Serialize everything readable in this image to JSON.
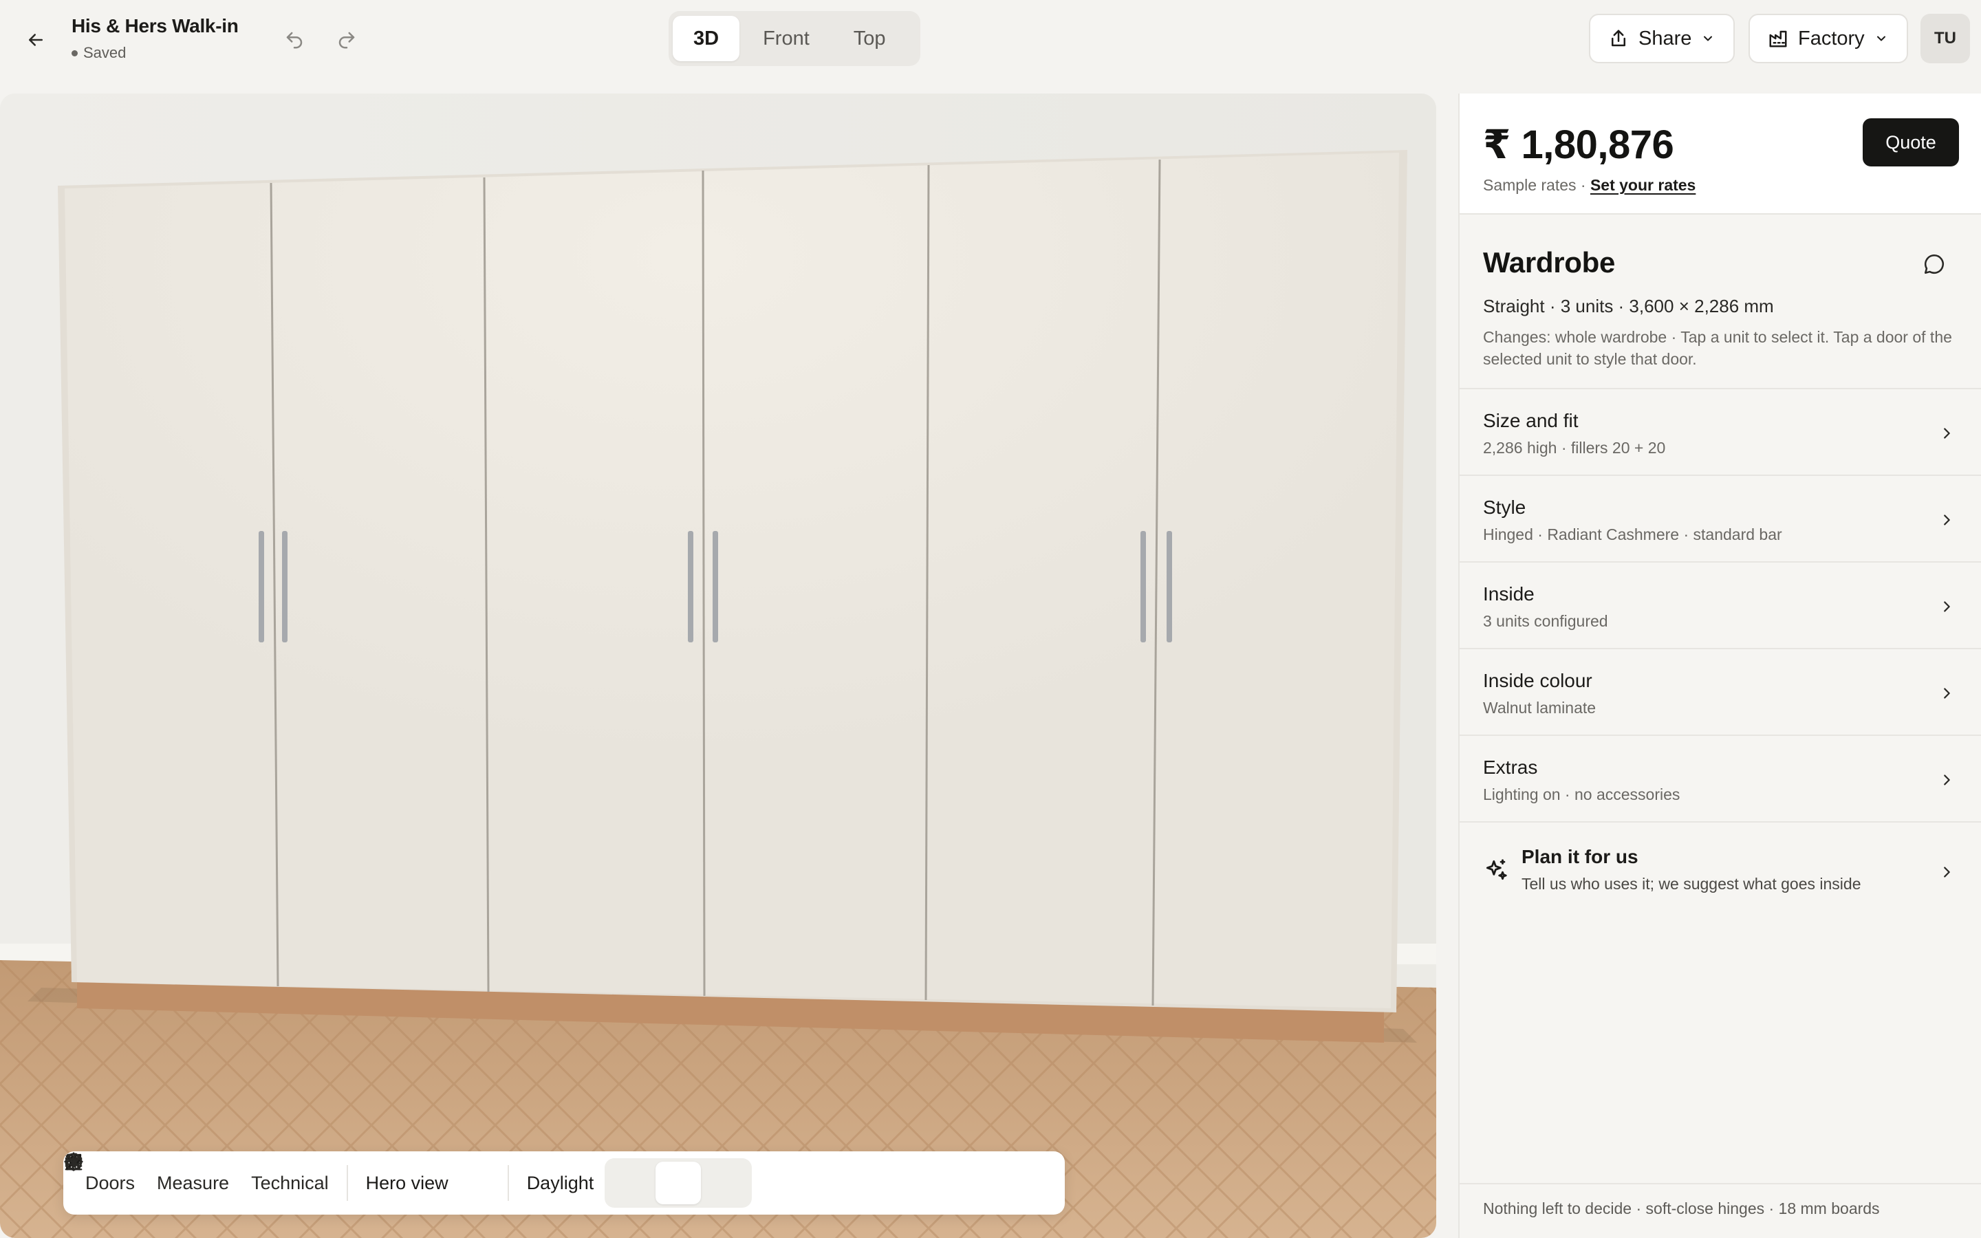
{
  "header": {
    "title": "His & Hers Walk-in",
    "status": "Saved",
    "views": [
      {
        "label": "3D",
        "active": true
      },
      {
        "label": "Front",
        "active": false
      },
      {
        "label": "Top",
        "active": false
      }
    ],
    "share_label": "Share",
    "factory_label": "Factory",
    "avatar_initials": "TU"
  },
  "toolbar": {
    "doors": "Doors",
    "measure": "Measure",
    "technical": "Technical",
    "camera": "Hero view",
    "lighting": "Daylight"
  },
  "panel": {
    "price": "₹ 1,80,876",
    "rates_prefix": "Sample rates ·",
    "rates_link": "Set your rates",
    "quote_label": "Quote",
    "wardrobe": {
      "title": "Wardrobe",
      "summary": "Straight · 3 units · 3,600 × 2,286 mm",
      "help": "Changes: whole wardrobe · Tap a unit to select it. Tap a door of the selected unit to style that door."
    },
    "rows": [
      {
        "title": "Size and fit",
        "sub": "2,286 high · fillers 20 + 20"
      },
      {
        "title": "Style",
        "sub": "Hinged · Radiant Cashmere · standard bar"
      },
      {
        "title": "Inside",
        "sub": "3 units configured"
      },
      {
        "title": "Inside colour",
        "sub": "Walnut laminate"
      },
      {
        "title": "Extras",
        "sub": "Lighting on · no accessories"
      }
    ],
    "plan": {
      "title": "Plan it for us",
      "sub": "Tell us who uses it; we suggest what goes inside"
    },
    "footer": "Nothing left to decide · soft-close hinges · 18 mm boards"
  },
  "colors": {
    "accent": "#161614",
    "door": "#ece8e1",
    "plinth": "#c08f68",
    "floor": "#c9a07a"
  }
}
